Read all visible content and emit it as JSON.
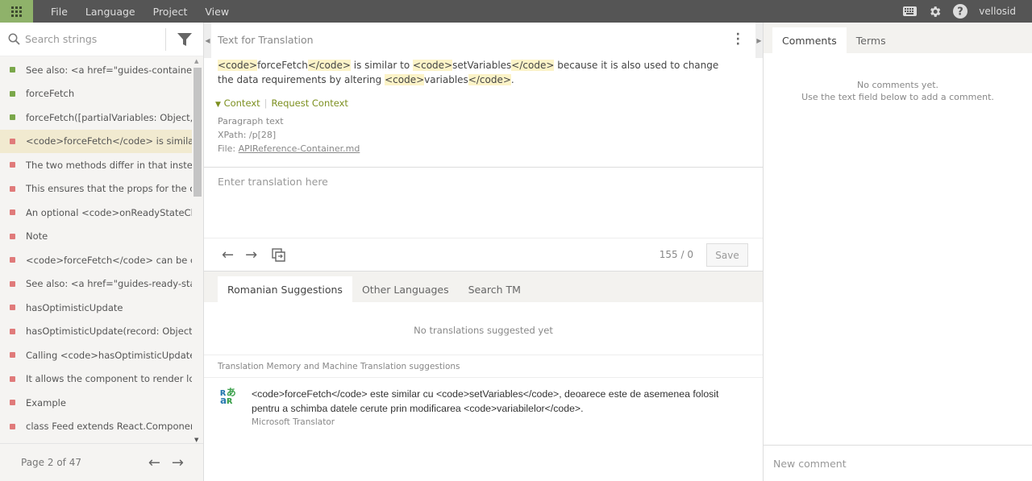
{
  "topbar": {
    "menu": [
      "File",
      "Language",
      "Project",
      "View"
    ],
    "username": "vellosid"
  },
  "colors": {
    "accent": "#8fb26a",
    "translated": "#7aa74a",
    "untranslated": "#e07a7a",
    "highlight": "#fcf3c7",
    "context": "#7c8f1f"
  },
  "sidebar": {
    "search_placeholder": "Search strings",
    "items": [
      {
        "text": "See also: <a href=\"guides-containers...",
        "status": "translated"
      },
      {
        "text": "forceFetch",
        "status": "translated"
      },
      {
        "text": "forceFetch([partialVariables: Object, ...",
        "status": "translated"
      },
      {
        "text": "<code>forceFetch</code> is similar ...",
        "status": "untranslated",
        "selected": true
      },
      {
        "text": "The two methods differ in that inste...",
        "status": "untranslated"
      },
      {
        "text": "This ensures that the props for the c...",
        "status": "untranslated"
      },
      {
        "text": "An optional <code>onReadyStateCh...",
        "status": "untranslated"
      },
      {
        "text": "Note",
        "status": "untranslated"
      },
      {
        "text": "<code>forceFetch</code> can be cal...",
        "status": "untranslated"
      },
      {
        "text": "See also: <a href=\"guides-ready-stat...",
        "status": "untranslated"
      },
      {
        "text": "hasOptimisticUpdate",
        "status": "untranslated"
      },
      {
        "text": "hasOptimisticUpdate(record: Object...",
        "status": "untranslated"
      },
      {
        "text": "Calling <code>hasOptimisticUpdate...",
        "status": "untranslated"
      },
      {
        "text": "It allows the component to render lo...",
        "status": "untranslated"
      },
      {
        "text": "Example",
        "status": "untranslated"
      },
      {
        "text": "class Feed extends React.Componen...",
        "status": "untranslated"
      }
    ],
    "page": "Page 2 of 47"
  },
  "source": {
    "label": "Text for Translation",
    "segments": [
      {
        "t": "<code>",
        "tag": true
      },
      {
        "t": "forceFetch"
      },
      {
        "t": "</code>",
        "tag": true
      },
      {
        "t": " is similar to "
      },
      {
        "t": "<code>",
        "tag": true
      },
      {
        "t": "setVariables"
      },
      {
        "t": "</code>",
        "tag": true
      },
      {
        "t": " because it is also used to change the data requirements by altering "
      },
      {
        "t": "<code>",
        "tag": true
      },
      {
        "t": "variables"
      },
      {
        "t": "</code>",
        "tag": true
      },
      {
        "t": "."
      }
    ],
    "context_label": "Context",
    "request_context": "Request Context",
    "paragraph": "Paragraph text",
    "xpath": "XPath: /p[28]",
    "file_label": "File: ",
    "file": "APIReference-Container.md"
  },
  "editor": {
    "placeholder": "Enter translation here",
    "count": "155 / 0",
    "save": "Save"
  },
  "suggestions": {
    "tabs": [
      "Romanian Suggestions",
      "Other Languages",
      "Search TM"
    ],
    "empty": "No translations suggested yet",
    "tm_header": "Translation Memory and Machine Translation suggestions",
    "mt_text": "<code>forceFetch</code> este similar cu <code>setVariables</code>, deoarece este de asemenea folosit pentru a schimba datele cerute prin modificarea <code>variabilelor</code>.",
    "mt_source": "Microsoft Translator"
  },
  "comments": {
    "tabs": [
      "Comments",
      "Terms"
    ],
    "empty1": "No comments yet.",
    "empty2": "Use the text field below to add a comment.",
    "placeholder": "New comment"
  }
}
